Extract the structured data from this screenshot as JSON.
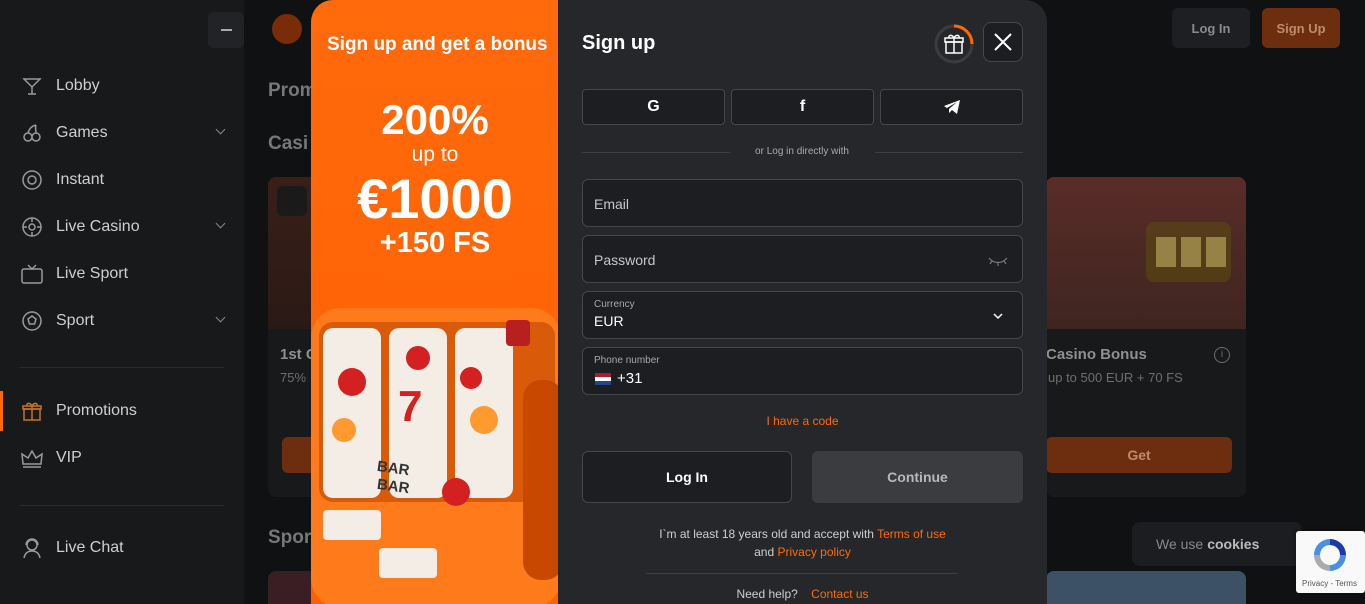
{
  "sidebar": {
    "items": [
      {
        "label": "Lobby",
        "icon": "cocktail-icon"
      },
      {
        "label": "Games",
        "icon": "cherries-icon",
        "expandable": true
      },
      {
        "label": "Instant",
        "icon": "instant-icon"
      },
      {
        "label": "Live Casino",
        "icon": "chip-icon",
        "expandable": true
      },
      {
        "label": "Live Sport",
        "icon": "live-tv-icon"
      },
      {
        "label": "Sport",
        "icon": "soccer-ball-icon",
        "expandable": true
      },
      {
        "label": "Promotions",
        "icon": "gift-icon",
        "active": true
      },
      {
        "label": "VIP",
        "icon": "crown-icon"
      },
      {
        "label": "Live Chat",
        "icon": "headset-icon"
      }
    ]
  },
  "topbar": {
    "login_label": "Log In",
    "signup_label": "Sign Up"
  },
  "background": {
    "section_promotions": "Prom",
    "section_casino": "Casi",
    "section_sport": "Spor",
    "card_left": {
      "title": "1st C",
      "sub": "75%"
    },
    "card_right": {
      "title": "Casino Bonus",
      "sub": "up to 500 EUR + 70 FS",
      "button": "Get"
    },
    "cookies_text": "We use",
    "cookies_bold": "cookies",
    "recaptcha_links": "Privacy - Terms"
  },
  "promo": {
    "heading": "Sign up and get a bonus",
    "percent": "200%",
    "up_to": "up to",
    "amount": "€1000",
    "free_spins": "+150 FS",
    "slot_symbols": [
      "7",
      "BAR",
      "BAR"
    ]
  },
  "signup": {
    "title": "Sign up",
    "social": [
      {
        "name": "google",
        "glyph": "G"
      },
      {
        "name": "facebook",
        "glyph": "f"
      },
      {
        "name": "telegram",
        "glyph": "➤"
      }
    ],
    "or_text": "or Log in directly with",
    "email_placeholder": "Email",
    "password_placeholder": "Password",
    "currency_label": "Currency",
    "currency_value": "EUR",
    "phone_label": "Phone number",
    "phone_prefix": "+31",
    "code_link": "I have a code",
    "login_button": "Log In",
    "continue_button": "Continue",
    "terms_prefix": "I`m at least 18 years old and accept with",
    "terms_link": "Terms of use",
    "terms_and": "and",
    "privacy_link": "Privacy policy",
    "help_text": "Need help?",
    "contact_link": "Contact us"
  },
  "colors": {
    "accent": "#ff6a00",
    "modal_bg": "#26272a",
    "sidebar_bg": "#18191b"
  }
}
